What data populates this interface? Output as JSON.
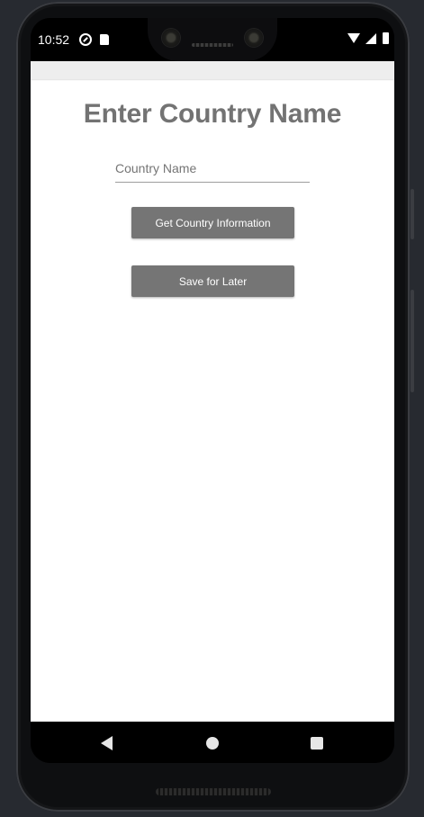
{
  "status_bar": {
    "time": "10:52",
    "icons": [
      "sync-icon",
      "sd-card-icon",
      "wifi-icon",
      "cell-signal-icon",
      "battery-icon"
    ]
  },
  "main": {
    "title": "Enter Country Name",
    "country_input": {
      "placeholder": "Country Name",
      "value": ""
    },
    "get_info_label": "Get Country Information",
    "save_label": "Save for Later"
  },
  "nav_bar": {
    "icons": [
      "back-icon",
      "home-icon",
      "recents-icon"
    ]
  },
  "colors": {
    "button_bg": "#757575",
    "title_color": "#737373",
    "app_bar_bg": "#eeeeee",
    "emulator_bg": "#272a30"
  }
}
